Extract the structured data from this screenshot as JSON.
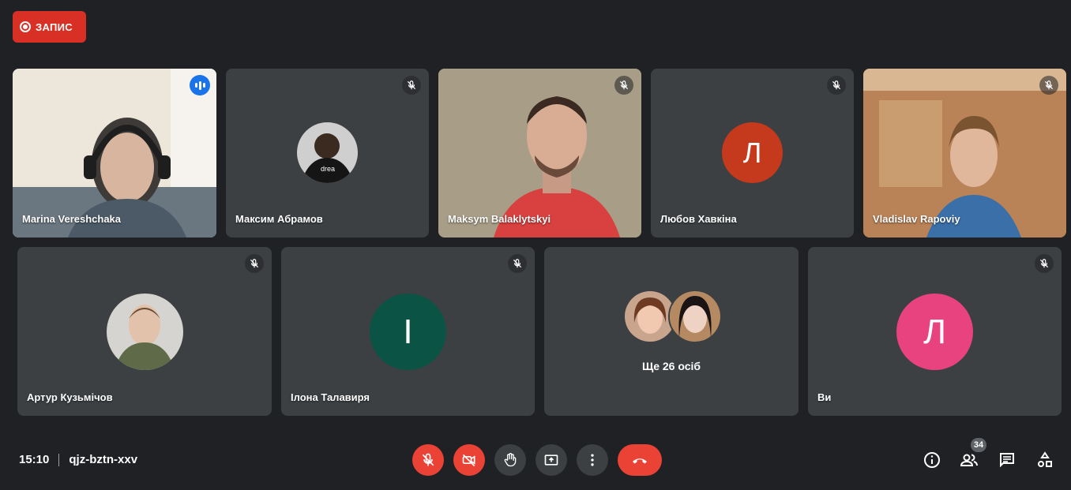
{
  "recording": {
    "label": "ЗАПИС"
  },
  "participants": [
    {
      "name": "Marina Vereshchaka",
      "status": "speaking"
    },
    {
      "name": "Максим Абрамов",
      "status": "muted"
    },
    {
      "name": "Maksym Balaklytskyi",
      "status": "muted"
    },
    {
      "name": "Любов Хавкіна",
      "status": "muted",
      "initial": "Л",
      "avatar_color": "#c5391c"
    },
    {
      "name": "Vladislav Rapoviy",
      "status": "muted"
    },
    {
      "name": "Артур Кузьмічов",
      "status": "muted"
    },
    {
      "name": "Ілона Талавиря",
      "status": "muted",
      "initial": "І",
      "avatar_color": "#0b5345"
    },
    {
      "name": "Ви",
      "status": "muted",
      "initial": "Л",
      "avatar_color": "#e8437e"
    }
  ],
  "others_tile": {
    "label": "Ще 26 осіб"
  },
  "meeting": {
    "time": "15:10",
    "code": "qjz-bztn-xxv"
  },
  "controls": [
    {
      "name": "mic-off",
      "color": "#ea4335"
    },
    {
      "name": "camera-off",
      "color": "#ea4335"
    },
    {
      "name": "raise-hand",
      "color": "#3c4043"
    },
    {
      "name": "present-screen",
      "color": "#3c4043"
    },
    {
      "name": "more-options",
      "color": "#3c4043"
    },
    {
      "name": "leave-call",
      "color": "#ea4335"
    }
  ],
  "right_panel": {
    "people_count": "34"
  },
  "colors": {
    "accent": "#8ab4f8",
    "danger": "#ea4335",
    "tile": "#3c4043",
    "background": "#202124"
  }
}
